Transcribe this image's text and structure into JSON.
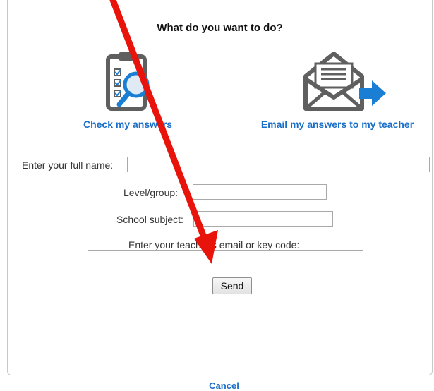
{
  "dialog": {
    "title": "What do you want to do?",
    "options": [
      {
        "label": "Check my answers",
        "icon": "clipboard-magnifier-icon"
      },
      {
        "label": "Email my answers to my teacher",
        "icon": "envelope-arrow-icon"
      }
    ],
    "fields": {
      "full_name": {
        "label": "Enter your full name:",
        "value": ""
      },
      "level": {
        "label": "Level/group:",
        "value": ""
      },
      "subject": {
        "label": "School subject:",
        "value": ""
      },
      "teacher": {
        "label": "Enter your teacher's email or key code:",
        "value": ""
      }
    },
    "send_label": "Send",
    "cancel_label": "Cancel"
  },
  "colors": {
    "link": "#1a6fc9",
    "icon_gray": "#5f5f5f",
    "icon_blue": "#1a7fd4",
    "annotation_arrow": "#e8140c"
  }
}
